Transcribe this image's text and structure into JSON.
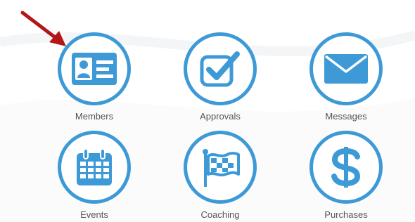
{
  "colors": {
    "accent": "#3d9ad6",
    "arrow": "#b31616",
    "label_text": "#555555"
  },
  "tiles": [
    {
      "label": "Members",
      "icon": "member-card-icon"
    },
    {
      "label": "Approvals",
      "icon": "checkbox-check-icon"
    },
    {
      "label": "Messages",
      "icon": "envelope-icon"
    },
    {
      "label": "Events",
      "icon": "calendar-icon"
    },
    {
      "label": "Coaching",
      "icon": "checkered-flag-icon"
    },
    {
      "label": "Purchases",
      "icon": "dollar-sign-icon"
    }
  ],
  "annotation": {
    "icon": "red-pointer-arrow-icon",
    "target": "Members"
  }
}
